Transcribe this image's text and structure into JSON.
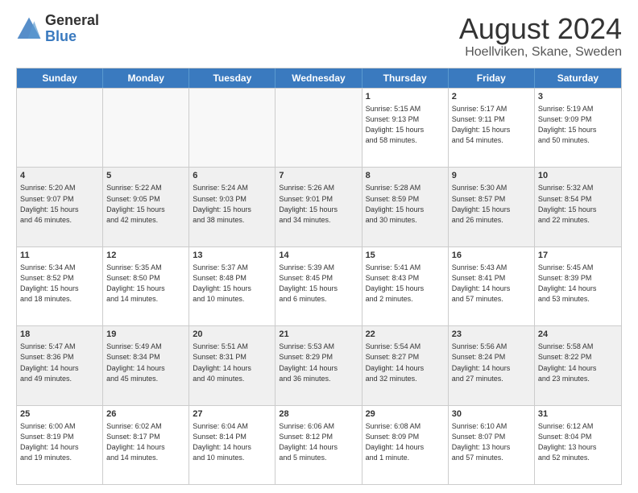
{
  "header": {
    "logo_line1": "General",
    "logo_line2": "Blue",
    "title": "August 2024",
    "subtitle": "Hoellviken, Skane, Sweden"
  },
  "weekdays": [
    "Sunday",
    "Monday",
    "Tuesday",
    "Wednesday",
    "Thursday",
    "Friday",
    "Saturday"
  ],
  "rows": [
    [
      {
        "day": "",
        "info": "",
        "empty": true
      },
      {
        "day": "",
        "info": "",
        "empty": true
      },
      {
        "day": "",
        "info": "",
        "empty": true
      },
      {
        "day": "",
        "info": "",
        "empty": true
      },
      {
        "day": "1",
        "info": "Sunrise: 5:15 AM\nSunset: 9:13 PM\nDaylight: 15 hours\nand 58 minutes.",
        "empty": false
      },
      {
        "day": "2",
        "info": "Sunrise: 5:17 AM\nSunset: 9:11 PM\nDaylight: 15 hours\nand 54 minutes.",
        "empty": false
      },
      {
        "day": "3",
        "info": "Sunrise: 5:19 AM\nSunset: 9:09 PM\nDaylight: 15 hours\nand 50 minutes.",
        "empty": false
      }
    ],
    [
      {
        "day": "4",
        "info": "Sunrise: 5:20 AM\nSunset: 9:07 PM\nDaylight: 15 hours\nand 46 minutes.",
        "empty": false
      },
      {
        "day": "5",
        "info": "Sunrise: 5:22 AM\nSunset: 9:05 PM\nDaylight: 15 hours\nand 42 minutes.",
        "empty": false
      },
      {
        "day": "6",
        "info": "Sunrise: 5:24 AM\nSunset: 9:03 PM\nDaylight: 15 hours\nand 38 minutes.",
        "empty": false
      },
      {
        "day": "7",
        "info": "Sunrise: 5:26 AM\nSunset: 9:01 PM\nDaylight: 15 hours\nand 34 minutes.",
        "empty": false
      },
      {
        "day": "8",
        "info": "Sunrise: 5:28 AM\nSunset: 8:59 PM\nDaylight: 15 hours\nand 30 minutes.",
        "empty": false
      },
      {
        "day": "9",
        "info": "Sunrise: 5:30 AM\nSunset: 8:57 PM\nDaylight: 15 hours\nand 26 minutes.",
        "empty": false
      },
      {
        "day": "10",
        "info": "Sunrise: 5:32 AM\nSunset: 8:54 PM\nDaylight: 15 hours\nand 22 minutes.",
        "empty": false
      }
    ],
    [
      {
        "day": "11",
        "info": "Sunrise: 5:34 AM\nSunset: 8:52 PM\nDaylight: 15 hours\nand 18 minutes.",
        "empty": false
      },
      {
        "day": "12",
        "info": "Sunrise: 5:35 AM\nSunset: 8:50 PM\nDaylight: 15 hours\nand 14 minutes.",
        "empty": false
      },
      {
        "day": "13",
        "info": "Sunrise: 5:37 AM\nSunset: 8:48 PM\nDaylight: 15 hours\nand 10 minutes.",
        "empty": false
      },
      {
        "day": "14",
        "info": "Sunrise: 5:39 AM\nSunset: 8:45 PM\nDaylight: 15 hours\nand 6 minutes.",
        "empty": false
      },
      {
        "day": "15",
        "info": "Sunrise: 5:41 AM\nSunset: 8:43 PM\nDaylight: 15 hours\nand 2 minutes.",
        "empty": false
      },
      {
        "day": "16",
        "info": "Sunrise: 5:43 AM\nSunset: 8:41 PM\nDaylight: 14 hours\nand 57 minutes.",
        "empty": false
      },
      {
        "day": "17",
        "info": "Sunrise: 5:45 AM\nSunset: 8:39 PM\nDaylight: 14 hours\nand 53 minutes.",
        "empty": false
      }
    ],
    [
      {
        "day": "18",
        "info": "Sunrise: 5:47 AM\nSunset: 8:36 PM\nDaylight: 14 hours\nand 49 minutes.",
        "empty": false
      },
      {
        "day": "19",
        "info": "Sunrise: 5:49 AM\nSunset: 8:34 PM\nDaylight: 14 hours\nand 45 minutes.",
        "empty": false
      },
      {
        "day": "20",
        "info": "Sunrise: 5:51 AM\nSunset: 8:31 PM\nDaylight: 14 hours\nand 40 minutes.",
        "empty": false
      },
      {
        "day": "21",
        "info": "Sunrise: 5:53 AM\nSunset: 8:29 PM\nDaylight: 14 hours\nand 36 minutes.",
        "empty": false
      },
      {
        "day": "22",
        "info": "Sunrise: 5:54 AM\nSunset: 8:27 PM\nDaylight: 14 hours\nand 32 minutes.",
        "empty": false
      },
      {
        "day": "23",
        "info": "Sunrise: 5:56 AM\nSunset: 8:24 PM\nDaylight: 14 hours\nand 27 minutes.",
        "empty": false
      },
      {
        "day": "24",
        "info": "Sunrise: 5:58 AM\nSunset: 8:22 PM\nDaylight: 14 hours\nand 23 minutes.",
        "empty": false
      }
    ],
    [
      {
        "day": "25",
        "info": "Sunrise: 6:00 AM\nSunset: 8:19 PM\nDaylight: 14 hours\nand 19 minutes.",
        "empty": false
      },
      {
        "day": "26",
        "info": "Sunrise: 6:02 AM\nSunset: 8:17 PM\nDaylight: 14 hours\nand 14 minutes.",
        "empty": false
      },
      {
        "day": "27",
        "info": "Sunrise: 6:04 AM\nSunset: 8:14 PM\nDaylight: 14 hours\nand 10 minutes.",
        "empty": false
      },
      {
        "day": "28",
        "info": "Sunrise: 6:06 AM\nSunset: 8:12 PM\nDaylight: 14 hours\nand 5 minutes.",
        "empty": false
      },
      {
        "day": "29",
        "info": "Sunrise: 6:08 AM\nSunset: 8:09 PM\nDaylight: 14 hours\nand 1 minute.",
        "empty": false
      },
      {
        "day": "30",
        "info": "Sunrise: 6:10 AM\nSunset: 8:07 PM\nDaylight: 13 hours\nand 57 minutes.",
        "empty": false
      },
      {
        "day": "31",
        "info": "Sunrise: 6:12 AM\nSunset: 8:04 PM\nDaylight: 13 hours\nand 52 minutes.",
        "empty": false
      }
    ]
  ]
}
